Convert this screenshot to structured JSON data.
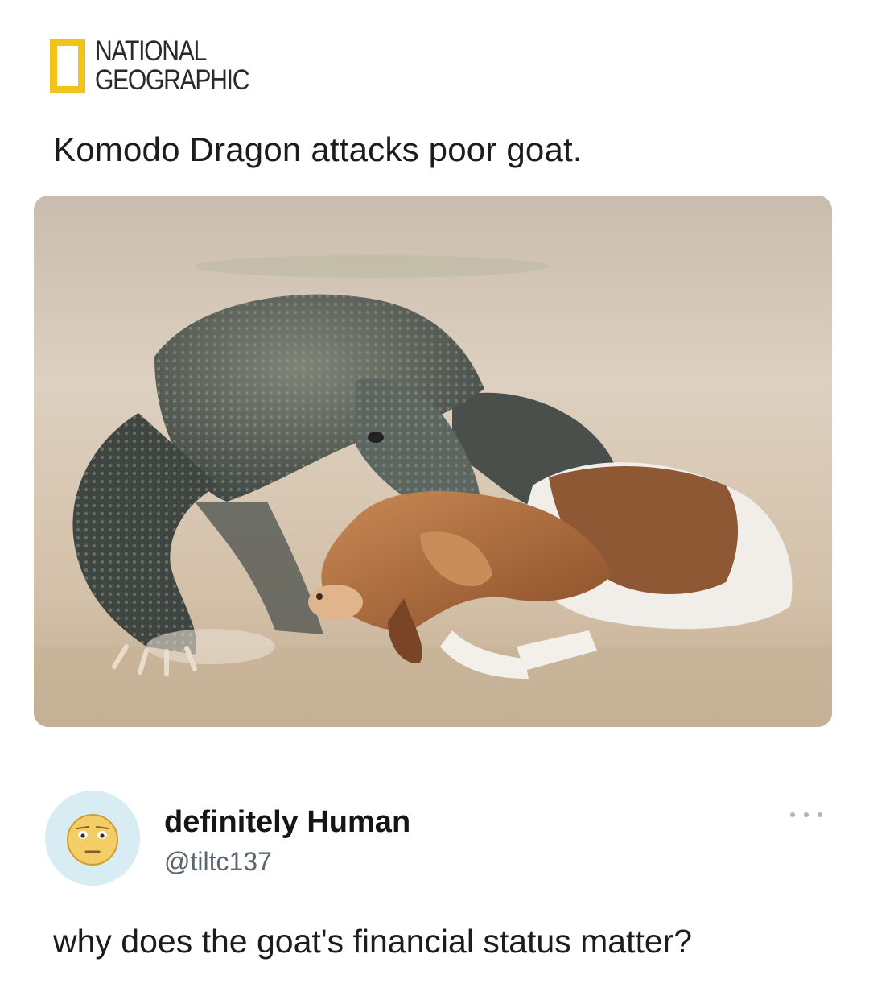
{
  "post": {
    "source": {
      "logo_line1": "NATIONAL",
      "logo_line2": "GEOGRAPHIC",
      "logo_color": "#f2c419"
    },
    "headline": "Komodo Dragon attacks poor goat.",
    "photo_icon": "photo-komodo-dragon-goat"
  },
  "reply": {
    "display_name": "definitely Human",
    "handle": "@tiltc137",
    "avatar_icon": "face-emoji-icon",
    "more_icon": "more-dots-icon",
    "text": "why does the goat's financial status matter?"
  }
}
